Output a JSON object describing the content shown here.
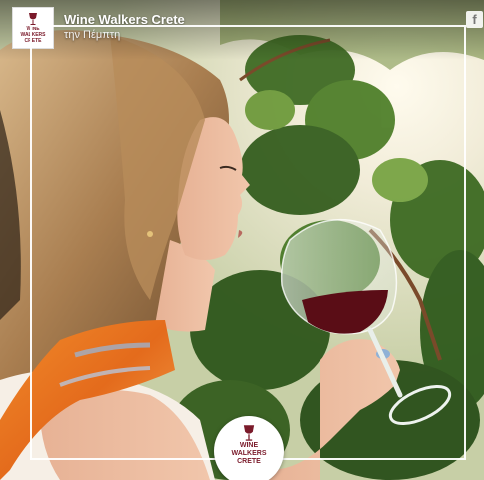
{
  "post": {
    "page_name": "Wine Walkers Crete",
    "time": "την Πέμπτη",
    "platform_icon": "facebook-icon"
  },
  "logo": {
    "line1": "WINE",
    "line2": "WALKERS",
    "line3": "CRETE",
    "color": "#7a1a2a"
  },
  "photo": {
    "subject": "woman-tasting-red-wine",
    "wine_color": "#5a0d16"
  }
}
